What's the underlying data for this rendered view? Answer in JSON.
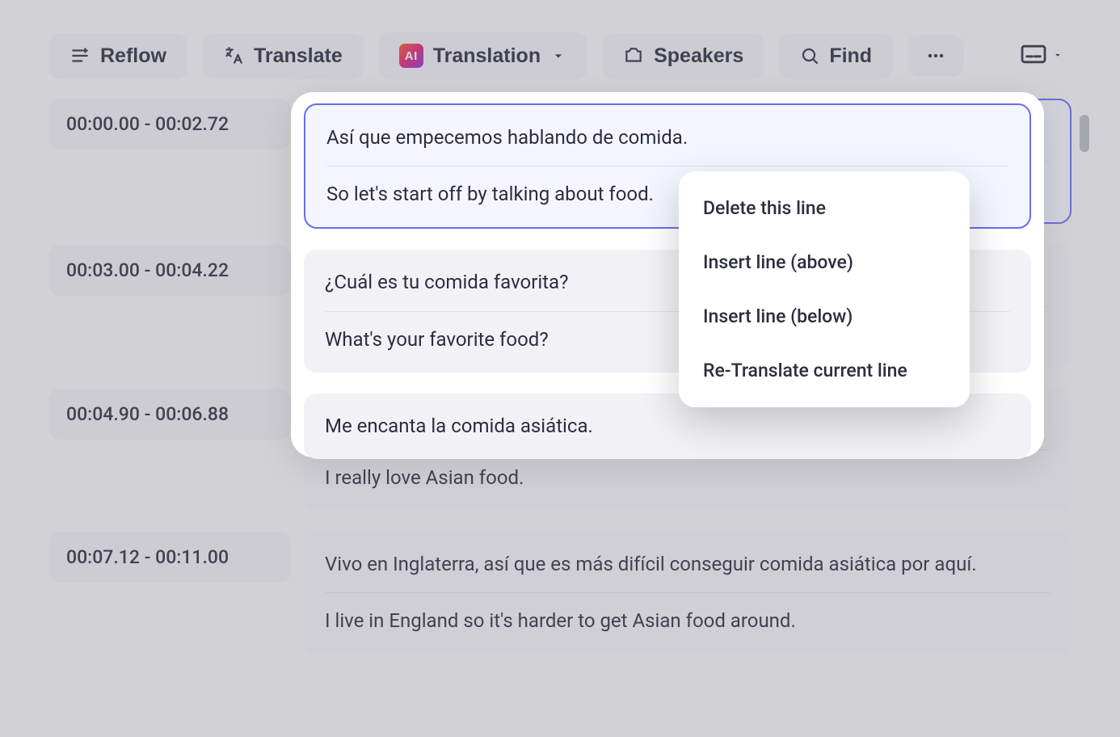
{
  "toolbar": {
    "reflow": "Reflow",
    "translate": "Translate",
    "translation": "Translation",
    "ai_badge": "AI",
    "speakers": "Speakers",
    "find": "Find"
  },
  "rows": [
    {
      "time": "00:00.00 - 00:02.72",
      "src": "Así que empecemos hablando de comida.",
      "trg": "So let's start off by talking about food.",
      "selected": true
    },
    {
      "time": "00:03.00 - 00:04.22",
      "src": "¿Cuál es tu comida favorita?",
      "trg": "What's your favorite food?",
      "selected": false
    },
    {
      "time": "00:04.90 - 00:06.88",
      "src": "Me encanta la comida asiática.",
      "trg": "I really love Asian food.",
      "selected": false
    },
    {
      "time": "00:07.12  -  00:11.00",
      "src": "Vivo en Inglaterra, así que es más difícil conseguir comida asiática por aquí.",
      "trg": "I live in England so it's harder to get Asian food around.",
      "selected": false
    }
  ],
  "context_menu": {
    "delete": "Delete this line",
    "insert_above": "Insert line (above)",
    "insert_below": "Insert line (below)",
    "retranslate": "Re-Translate current line"
  }
}
